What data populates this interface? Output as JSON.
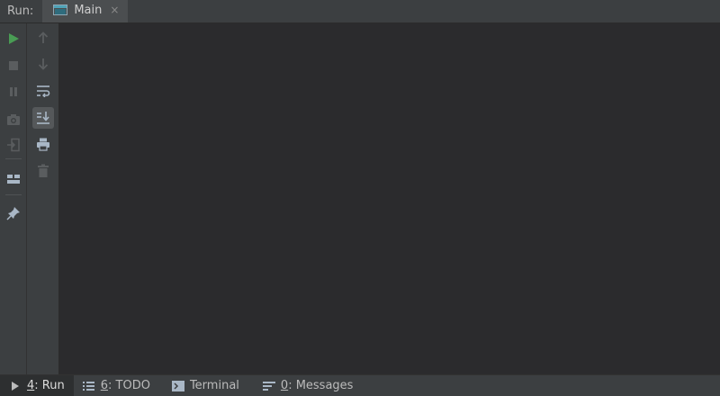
{
  "run_panel": {
    "label": "Run:",
    "tabs": [
      {
        "label": "Main",
        "icon": "console-window-icon",
        "close": "×"
      }
    ]
  },
  "left_toolbar": {
    "col1": [
      "rerun-play-icon",
      "stop-icon",
      "pause-icon",
      "camera-icon",
      "exit-icon",
      "layout-icon",
      "pin-icon"
    ],
    "col2": [
      "up-arrow-icon",
      "down-arrow-icon",
      "soft-wrap-icon",
      "scroll-to-end-icon",
      "print-icon",
      "trash-icon"
    ]
  },
  "bottom_bar": {
    "tabs": [
      {
        "key": "4",
        "rest": ": Run",
        "icon": "run-icon",
        "active": true
      },
      {
        "key": "6",
        "rest": ": TODO",
        "icon": "todo-list-icon",
        "active": false
      },
      {
        "key": "",
        "rest": "Terminal",
        "icon": "terminal-icon",
        "active": false
      },
      {
        "key": "0",
        "rest": ": Messages",
        "icon": "messages-icon",
        "active": false
      }
    ]
  },
  "colors": {
    "accent_green": "#499c54",
    "background": "#2b2b2d",
    "panel": "#3c3f41"
  }
}
